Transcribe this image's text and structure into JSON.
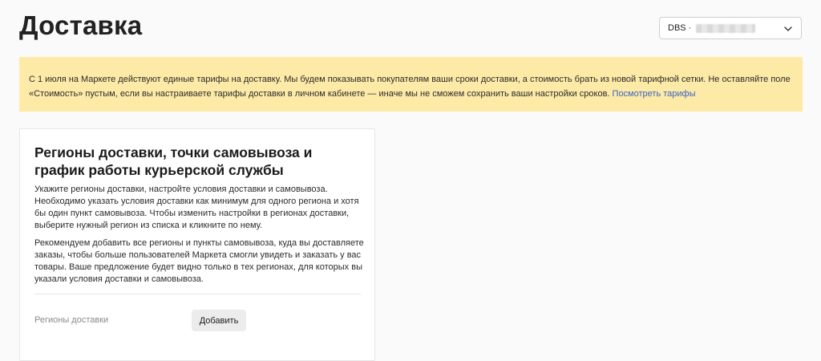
{
  "header": {
    "title": "Доставка"
  },
  "store_select": {
    "prefix": "DBS ·",
    "icon": "chevron-down-icon"
  },
  "notice": {
    "text": "С 1 июля на Маркете действуют единые тарифы на доставку. Мы будем показывать покупателям ваши сроки доставки, а стоимость брать из новой тарифной сетки. Не оставляйте поле «Стоимость» пустым, если вы настраиваете тарифы доставки в личном кабинете — иначе мы не сможем сохранить ваши настройки сроков. ",
    "link_label": "Посмотреть тарифы",
    "background_color": "#fdeaa6",
    "link_color": "#3a62c6"
  },
  "card": {
    "title": "Регионы доставки, точки самовывоза и график работы курьерской службы",
    "paragraph_1": "Укажите регионы доставки, настройте условия доставки и самовывоза. Необходимо указать условия доставки как минимум для одного региона и хотя бы один пункт самовывоза. Чтобы изменить настройки в регионах доставки, выберите нужный регион из списка и кликните по нему.",
    "paragraph_2": "Рекомендуем добавить все регионы и пункты самовывоза, куда вы доставляете заказы, чтобы больше пользователей Маркета смогли увидеть и заказать у вас товары. Ваше предложение будет видно только в тех регионах, для которых вы указали условия доставки и самовывоза.",
    "regions_label": "Регионы доставки",
    "add_button_label": "Добавить"
  }
}
